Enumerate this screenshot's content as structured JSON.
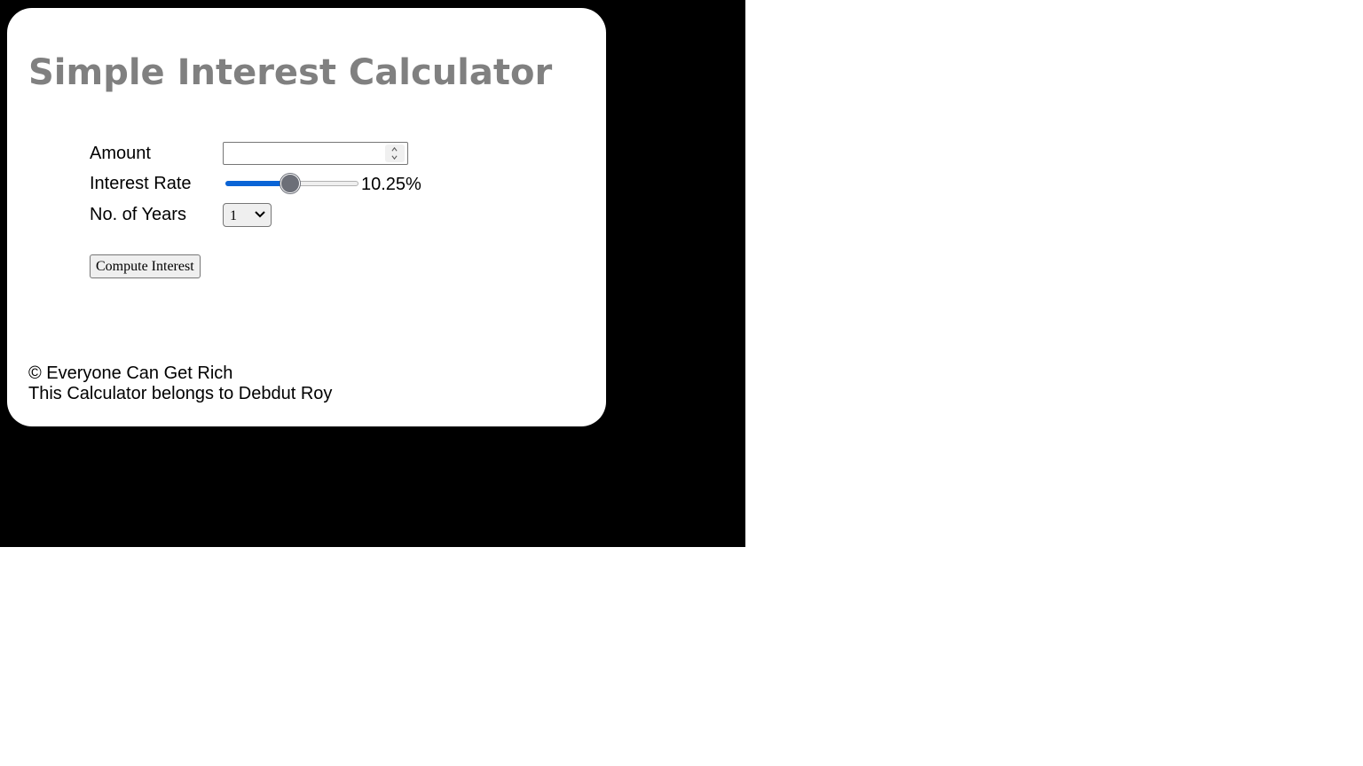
{
  "title": "Simple Interest Calculator",
  "form": {
    "amount_label": "Amount",
    "amount_value": "",
    "rate_label": "Interest Rate",
    "rate_value": 10.25,
    "rate_min": 1,
    "rate_max": 20,
    "rate_display": "10.25%",
    "years_label": "No. of Years",
    "years_selected": "1",
    "compute_label": "Compute Interest"
  },
  "footer": {
    "copyright": "© Everyone Can Get Rich",
    "owner": "This Calculator belongs to Debdut Roy"
  },
  "colors": {
    "page_background": "#000000",
    "card_background": "#ffffff",
    "title": "#808080",
    "slider_fill": "#0a64d6",
    "slider_thumb": "#6c6f78"
  }
}
